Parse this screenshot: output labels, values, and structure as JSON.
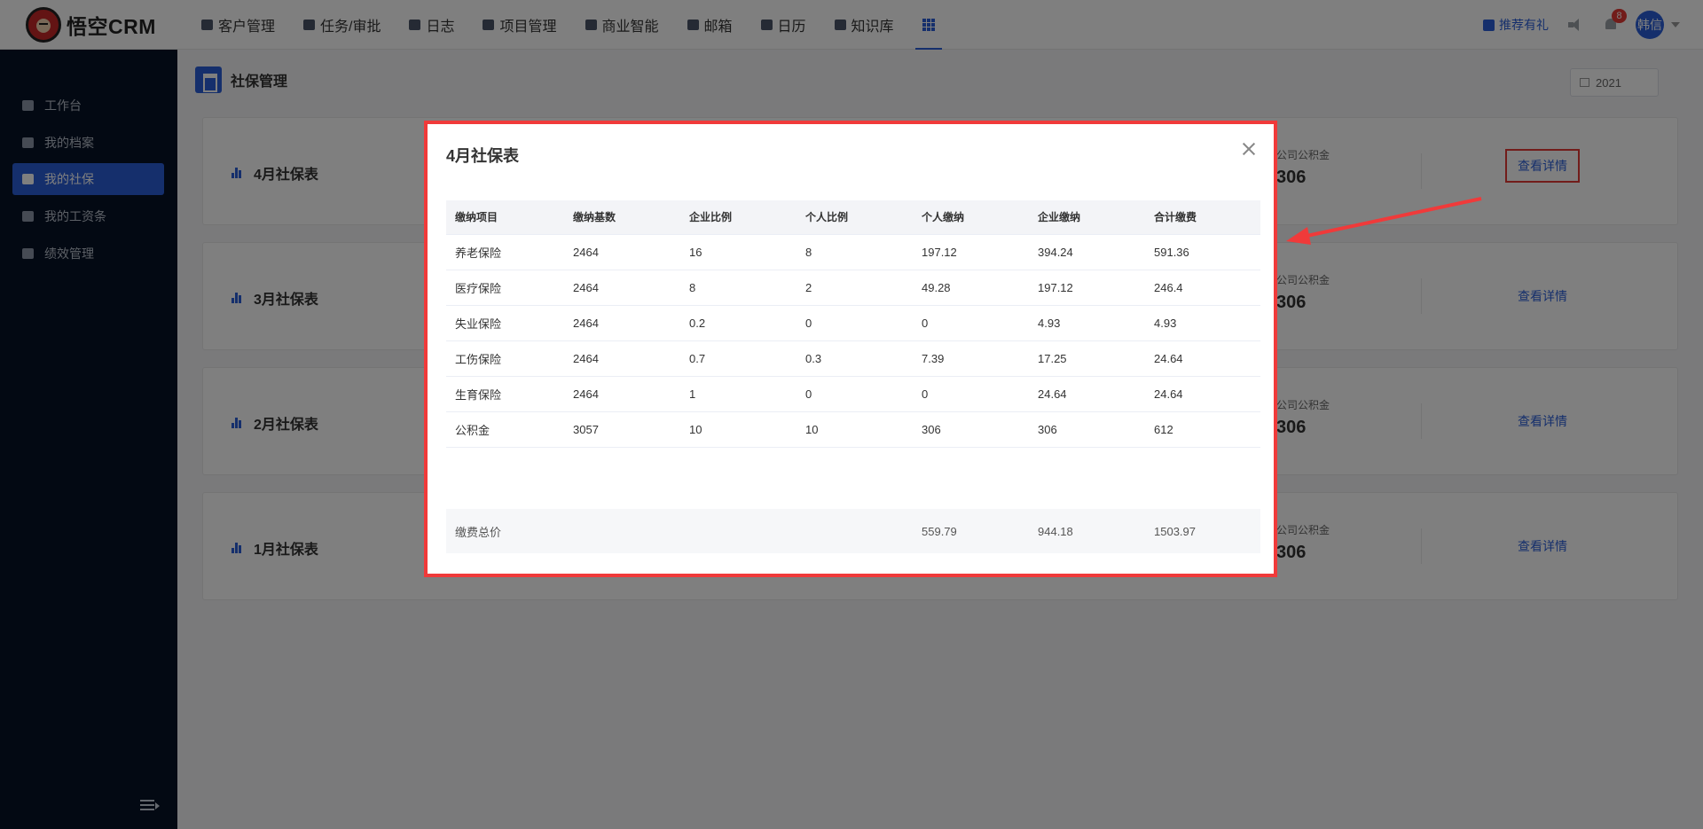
{
  "app": {
    "name": "悟空CRM"
  },
  "nav": [
    {
      "label": "客户管理",
      "icon": "building-icon"
    },
    {
      "label": "任务/审批",
      "icon": "briefcase-icon"
    },
    {
      "label": "日志",
      "icon": "notebook-icon"
    },
    {
      "label": "项目管理",
      "icon": "list-icon"
    },
    {
      "label": "商业智能",
      "icon": "shield-check-icon"
    },
    {
      "label": "邮箱",
      "icon": "envelope-icon"
    },
    {
      "label": "日历",
      "icon": "calendar-icon"
    },
    {
      "label": "知识库",
      "icon": "book-icon"
    }
  ],
  "topRight": {
    "gift": "推荐有礼",
    "notifications": "8",
    "user": "韩信"
  },
  "sidebar": [
    {
      "label": "工作台",
      "icon": "monitor-icon"
    },
    {
      "label": "我的档案",
      "icon": "briefcase-icon"
    },
    {
      "label": "我的社保",
      "icon": "shield-icon",
      "active": true
    },
    {
      "label": "我的工资条",
      "icon": "document-icon"
    },
    {
      "label": "绩效管理",
      "icon": "chart-icon"
    }
  ],
  "page": {
    "title": "社保管理",
    "year": "2021"
  },
  "cards": [
    {
      "title": "4月社保表",
      "statLabel": "公司公积金",
      "statValue": "306",
      "link": "查看详情"
    },
    {
      "title": "3月社保表",
      "statLabel": "公司公积金",
      "statValue": "306",
      "link": "查看详情"
    },
    {
      "title": "2月社保表",
      "statLabel": "公司公积金",
      "statValue": "306",
      "link": "查看详情"
    },
    {
      "title": "1月社保表",
      "statLabel": "公司公积金",
      "statValue": "306",
      "link": "查看详情"
    }
  ],
  "modal": {
    "title": "4月社保表",
    "columns": [
      "缴纳项目",
      "缴纳基数",
      "企业比例",
      "个人比例",
      "个人缴纳",
      "企业缴纳",
      "合计缴费"
    ],
    "rows": [
      [
        "养老保险",
        "2464",
        "16",
        "8",
        "197.12",
        "394.24",
        "591.36"
      ],
      [
        "医疗保险",
        "2464",
        "8",
        "2",
        "49.28",
        "197.12",
        "246.4"
      ],
      [
        "失业保险",
        "2464",
        "0.2",
        "0",
        "0",
        "4.93",
        "4.93"
      ],
      [
        "工伤保险",
        "2464",
        "0.7",
        "0.3",
        "7.39",
        "17.25",
        "24.64"
      ],
      [
        "生育保险",
        "2464",
        "1",
        "0",
        "0",
        "24.64",
        "24.64"
      ],
      [
        "公积金",
        "3057",
        "10",
        "10",
        "306",
        "306",
        "612"
      ]
    ],
    "total": [
      "缴费总价",
      "",
      "",
      "",
      "559.79",
      "944.18",
      "1503.97"
    ]
  },
  "colors": {
    "accent": "#2b5fd9",
    "highlight": "#f03a3a",
    "sidebar": "#071226"
  }
}
